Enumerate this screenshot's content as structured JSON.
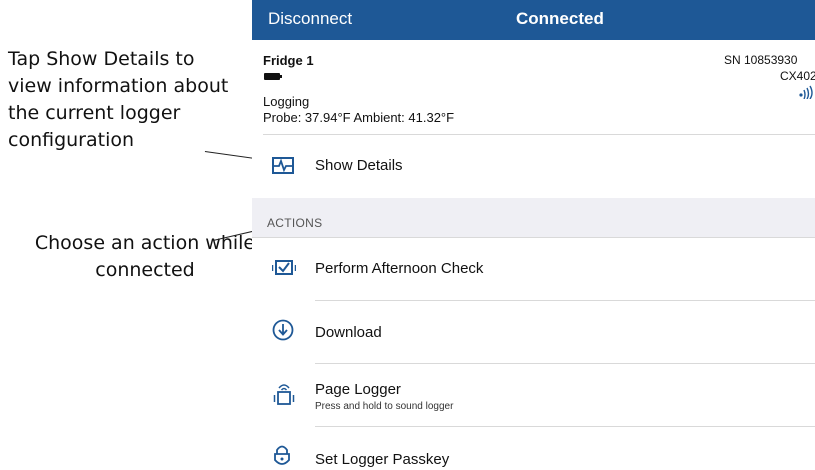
{
  "annotations": {
    "details_callout": "Tap Show Details to view information about the current logger configuration",
    "actions_callout": "Choose an action while connected"
  },
  "navbar": {
    "left_button": "Disconnect",
    "title": "Connected",
    "background": "#1e5896"
  },
  "device": {
    "name": "Fridge 1",
    "status": "Logging",
    "reading": "Probe: 37.94°F Ambient: 41.32°F",
    "serial": "SN 10853930",
    "model": "CX402",
    "battery_icon": "battery-icon",
    "signal_icon": "signal-icon"
  },
  "details": {
    "label": "Show Details",
    "icon": "waveform-icon"
  },
  "actions": {
    "header": "ACTIONS",
    "items": [
      {
        "label": "Perform Afternoon Check",
        "icon": "checkbox-icon"
      },
      {
        "label": "Download",
        "icon": "download-icon"
      },
      {
        "label": "Page Logger",
        "subtitle": "Press and hold to sound logger",
        "icon": "page-logger-icon"
      },
      {
        "label": "Set Logger Passkey",
        "icon": "lock-icon"
      }
    ]
  },
  "colors": {
    "accent": "#1e5896",
    "section_bg": "#efeff4"
  }
}
